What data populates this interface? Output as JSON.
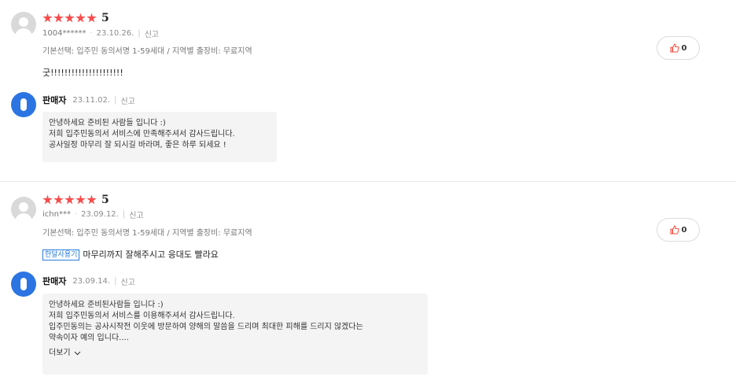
{
  "reviews": [
    {
      "rating": "5",
      "user_id": "1004******",
      "date": "23.10.26.",
      "report": "신고",
      "option": "기본선택: 입주민 동의서명 1-59세대 / 지역별 출장비: 무료지역",
      "tag": "",
      "text": "굿!!!!!!!!!!!!!!!!!!!!!",
      "likes": "0",
      "seller": {
        "name": "판매자",
        "date": "23.11.02.",
        "report": "신고",
        "lines": [
          "안녕하세요 준비된 사람들 입니다 :)",
          "저희 입주민동의서 서비스에 만족해주셔서 감사드립니다.",
          "공사일정 마무리 잘 되시길 바라며, 좋은 하루 되세요 !"
        ],
        "more": ""
      }
    },
    {
      "rating": "5",
      "user_id": "ichn***",
      "date": "23.09.12.",
      "report": "신고",
      "option": "기본선택: 입주민 동의서명 1-59세대 / 지역별 출장비: 무료지역",
      "tag": "한달사용기",
      "text": "마무리까지 잘해주시고 응대도 빨라요",
      "likes": "0",
      "seller": {
        "name": "판매자",
        "date": "23.09.14.",
        "report": "신고",
        "lines": [
          "안녕하세요 준비된사람들 입니다 :)",
          "저희 입주민동의서 서비스를 이용해주셔서 감사드립니다.",
          "입주민동의는 공사시작전 이웃에 방문하여 양해의 말씀을 드리며 최대한 피해를 드리지 않겠다는",
          "약속이자 예의 입니다...."
        ],
        "more": "더보기"
      }
    }
  ],
  "colors": {
    "star": "#f74c4c",
    "tag": "#2b7cd9",
    "seller_avatar": "#2b74e2",
    "like_icon": "#f04b3c"
  },
  "icons": {
    "avatar": "user-silhouette-icon",
    "seller": "seller-logo-icon",
    "like": "thumbs-up-icon",
    "more": "chevron-down-icon"
  }
}
